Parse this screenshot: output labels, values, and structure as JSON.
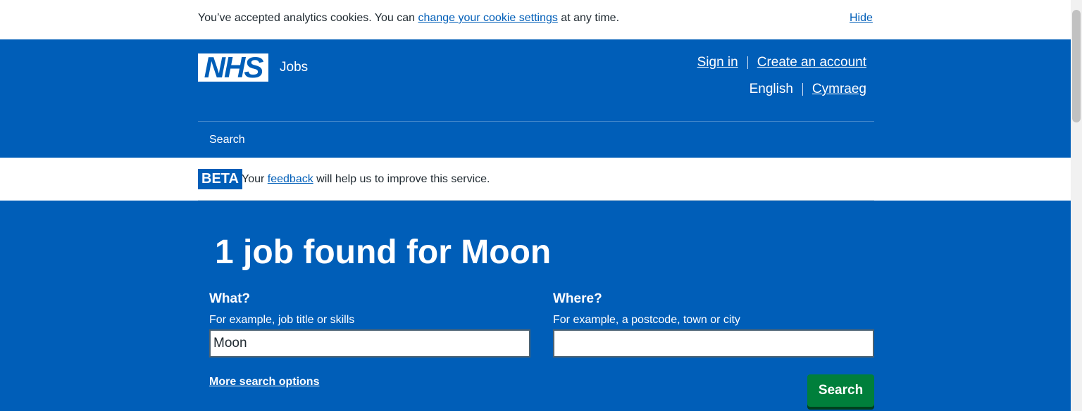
{
  "cookie_banner": {
    "text_before": "You’ve accepted analytics cookies. You can ",
    "link": "change your cookie settings",
    "text_after": " at any time.",
    "hide": "Hide"
  },
  "header": {
    "logo": "NHS",
    "service": "Jobs",
    "sign_in": "Sign in",
    "create_account": "Create an account",
    "lang_current": "English",
    "lang_other": "Cymraeg",
    "nav_search": "Search"
  },
  "beta": {
    "tag": "BETA",
    "text_before": "Your ",
    "link": "feedback",
    "text_after": " will help us to improve this service."
  },
  "search": {
    "title": "1 job found for Moon",
    "what_label": "What?",
    "what_hint": "For example, job title or skills",
    "what_value": "Moon",
    "where_label": "Where?",
    "where_hint": "For example, a postcode, town or city",
    "where_value": "",
    "more_options": "More search options",
    "button": "Search"
  },
  "colors": {
    "nhs_blue": "#005eb8",
    "button_green": "#007f3b"
  }
}
